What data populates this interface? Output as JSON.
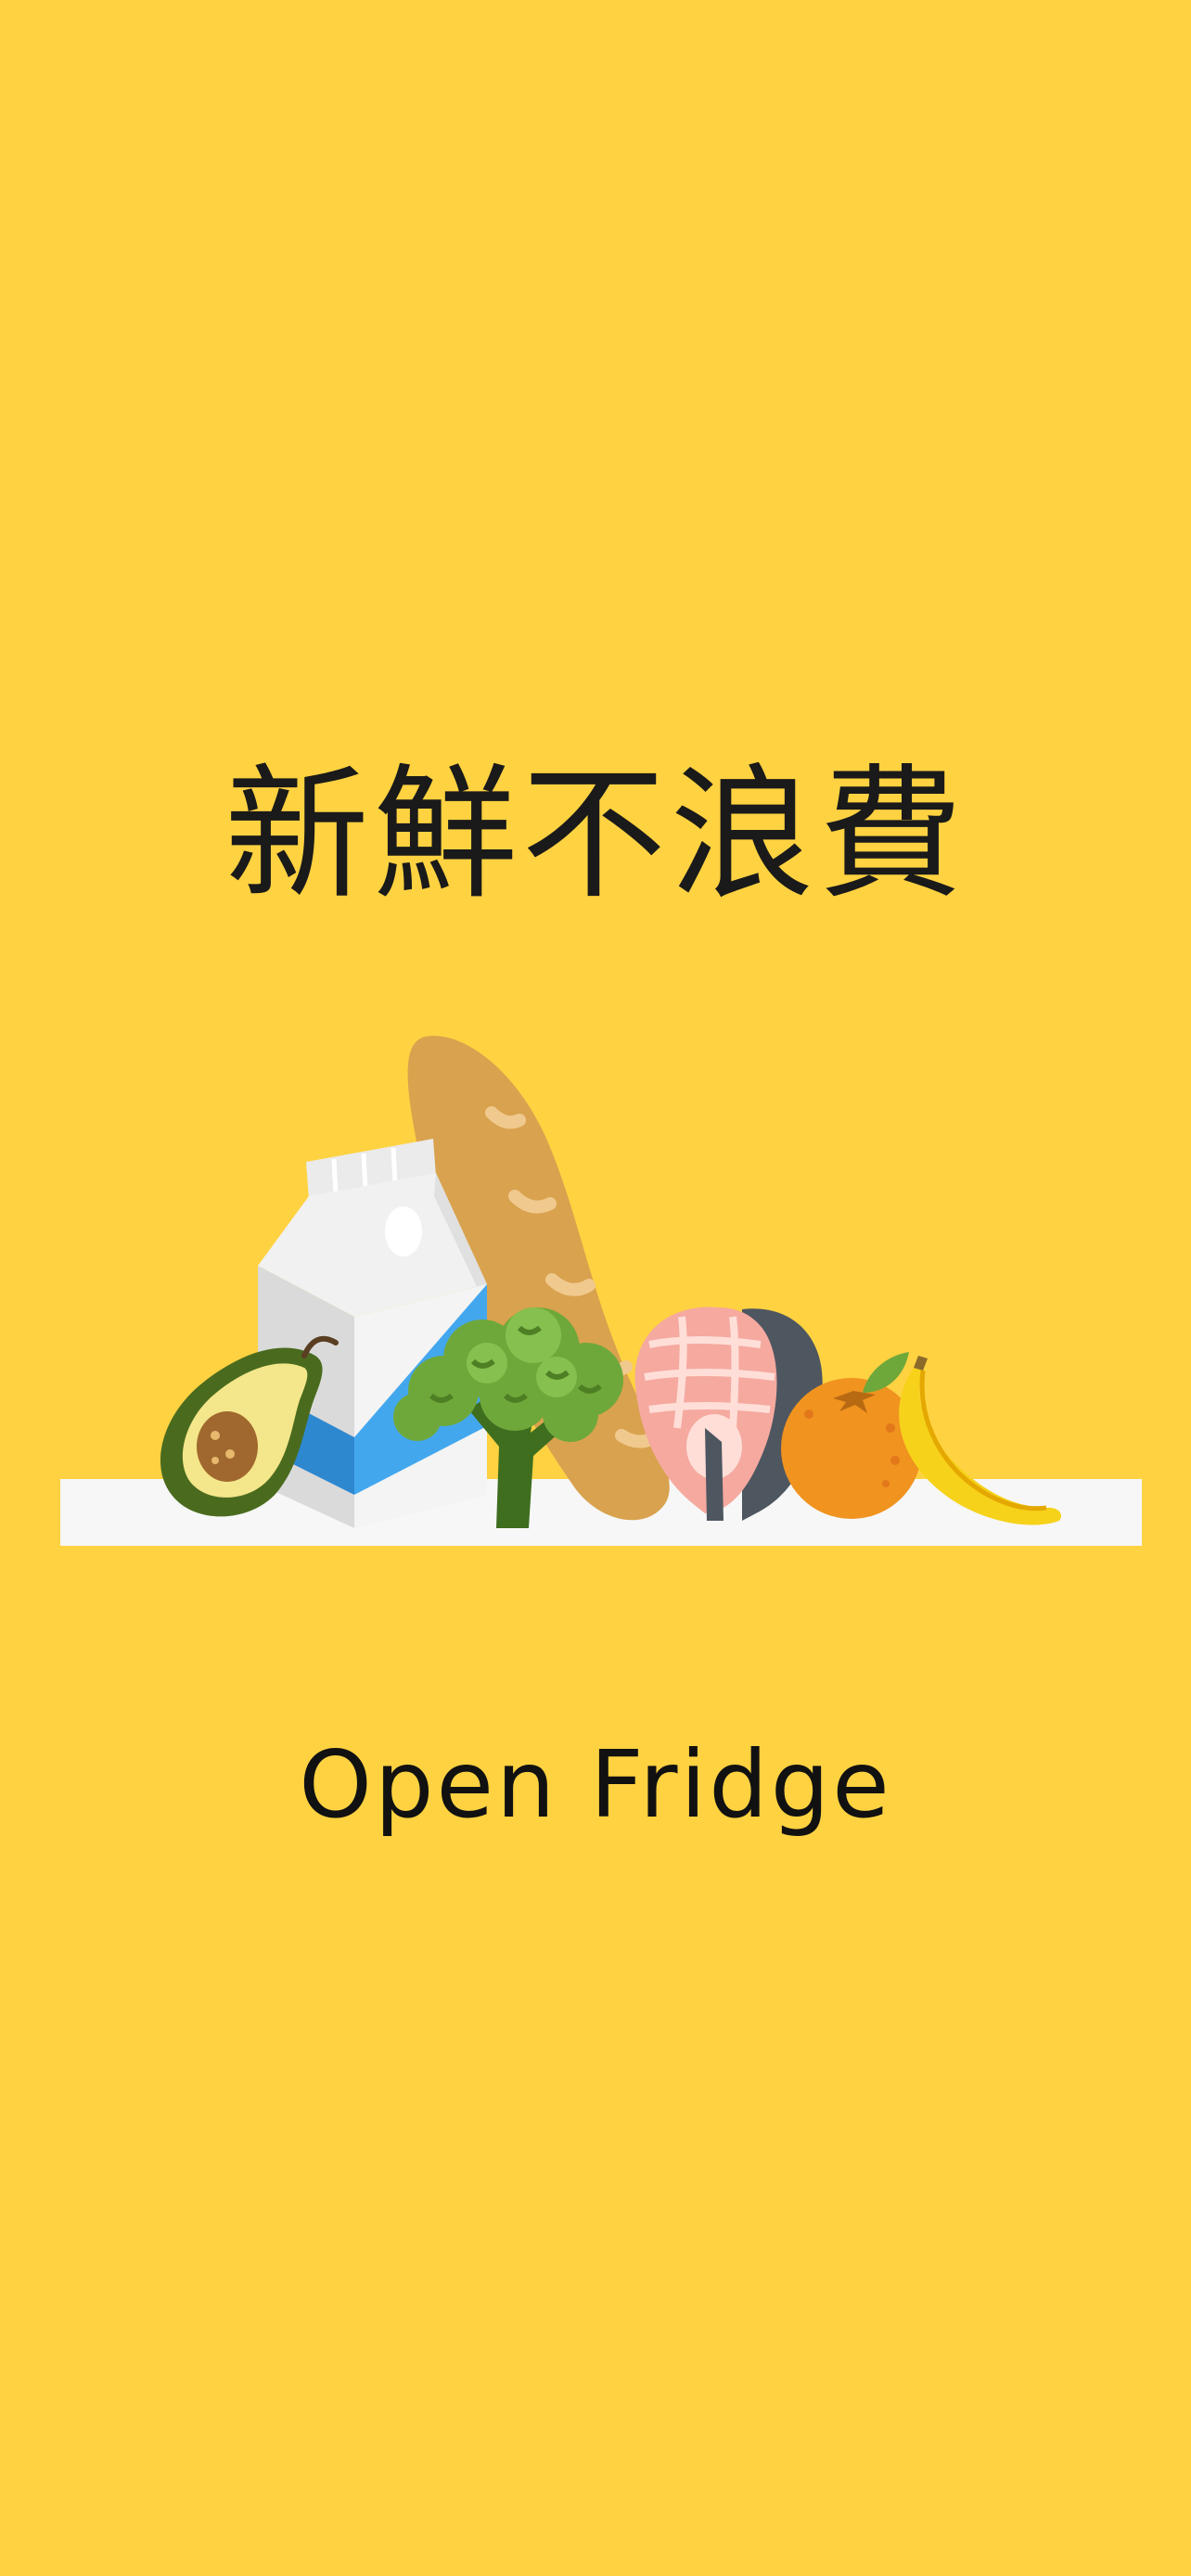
{
  "screen": {
    "name": "splash",
    "background_color": "#FFD241"
  },
  "tagline": "新鮮不浪費",
  "app_name": "Open Fridge",
  "illustration": {
    "items": [
      {
        "name": "milk-carton-icon"
      },
      {
        "name": "baguette-icon"
      },
      {
        "name": "avocado-icon"
      },
      {
        "name": "broccoli-icon"
      },
      {
        "name": "salmon-steak-icon"
      },
      {
        "name": "orange-icon"
      },
      {
        "name": "banana-icon"
      }
    ],
    "colors": {
      "shelf": "#F7F7F7",
      "bread": "#D9A24E",
      "milk_blue": "#2E9BE0",
      "avocado_skin": "#4A6B1E",
      "broccoli": "#6FA83A",
      "salmon": "#F5A99F",
      "orange": "#F0931F",
      "banana": "#F6D21A"
    }
  }
}
